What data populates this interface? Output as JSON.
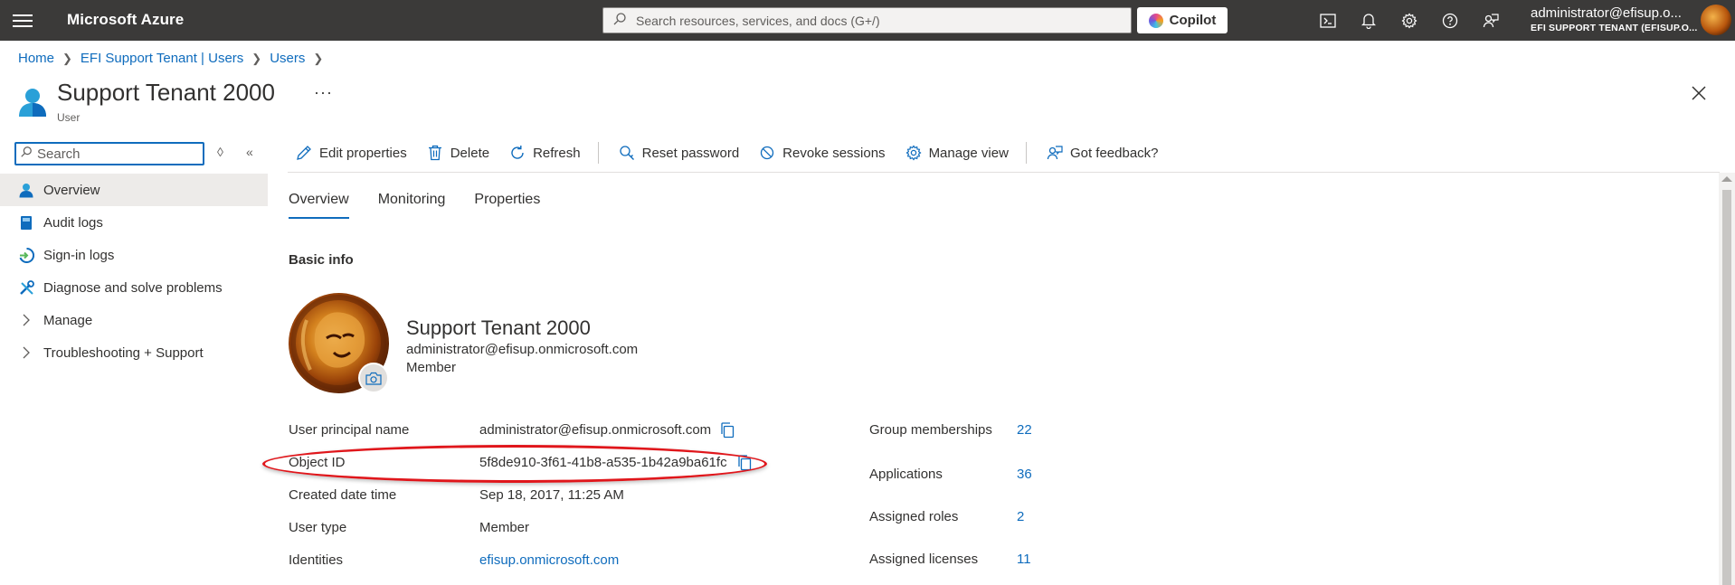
{
  "topbar": {
    "brand": "Microsoft Azure",
    "search_placeholder": "Search resources, services, and docs (G+/)",
    "copilot_label": "Copilot",
    "account_name": "administrator@efisup.o...",
    "account_tenant": "EFI SUPPORT TENANT (EFISUP.O..."
  },
  "breadcrumb": {
    "items": [
      "Home",
      "EFI Support Tenant | Users",
      "Users"
    ]
  },
  "page": {
    "title": "Support Tenant 2000",
    "more": "···",
    "subtitle": "User"
  },
  "nav": {
    "search_placeholder": "Search",
    "items": [
      {
        "label": "Overview",
        "icon": "user-icon"
      },
      {
        "label": "Audit logs",
        "icon": "book-icon"
      },
      {
        "label": "Sign-in logs",
        "icon": "sign-in-icon"
      },
      {
        "label": "Diagnose and solve problems",
        "icon": "wrench-icon"
      },
      {
        "label": "Manage",
        "icon": "chevron-right-icon"
      },
      {
        "label": "Troubleshooting + Support",
        "icon": "chevron-right-icon"
      }
    ]
  },
  "commands": {
    "edit": "Edit properties",
    "delete": "Delete",
    "refresh": "Refresh",
    "reset_password": "Reset password",
    "revoke_sessions": "Revoke sessions",
    "manage_view": "Manage view",
    "feedback": "Got feedback?"
  },
  "tabs": [
    "Overview",
    "Monitoring",
    "Properties"
  ],
  "basic_info": {
    "title": "Basic info",
    "name": "Support Tenant 2000",
    "email": "administrator@efisup.onmicrosoft.com",
    "type": "Member"
  },
  "properties": {
    "upn_label": "User principal name",
    "upn_value": "administrator@efisup.onmicrosoft.com",
    "object_id_label": "Object ID",
    "object_id_value": "5f8de910-3f61-41b8-a535-1b42a9ba61fc",
    "created_label": "Created date time",
    "created_value": "Sep 18, 2017, 11:25 AM",
    "user_type_label": "User type",
    "user_type_value": "Member",
    "identities_label": "Identities",
    "identities_value": "efisup.onmicrosoft.com"
  },
  "stats": {
    "groups_label": "Group memberships",
    "groups_value": "22",
    "apps_label": "Applications",
    "apps_value": "36",
    "roles_label": "Assigned roles",
    "roles_value": "2",
    "licenses_label": "Assigned licenses",
    "licenses_value": "11"
  },
  "colors": {
    "accent": "#0f6cbd",
    "topbar": "#3b3a39",
    "highlight": "#e0161b"
  }
}
